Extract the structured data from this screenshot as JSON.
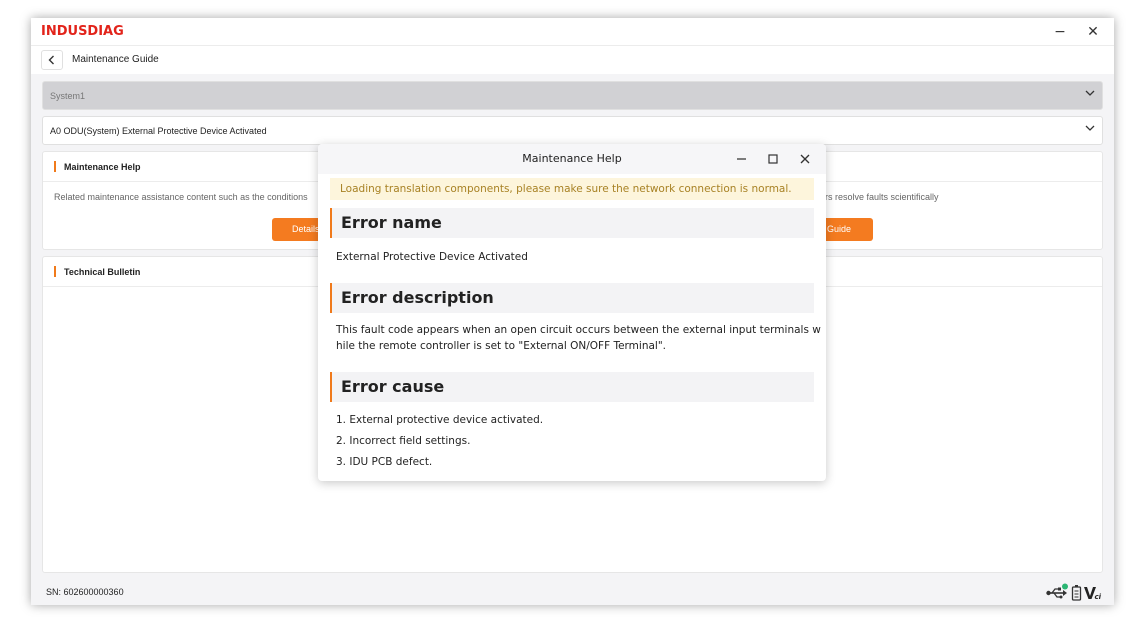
{
  "app": {
    "logo": "INDUSDIAG",
    "minimize": "−",
    "close": "✕"
  },
  "nav": {
    "title": "Maintenance Guide"
  },
  "selects": {
    "system": "System1",
    "fault": "A0 ODU(System) External Protective Device Activated"
  },
  "maintenance_help": {
    "title": "Maintenance Help",
    "desc_left": "Related maintenance assistance content such as the conditions",
    "desc_right": "ers resolve faults scientifically",
    "details_btn": "Details",
    "guide_btn": "Guide"
  },
  "technical_bulletin": {
    "title": "Technical Bulletin"
  },
  "status": {
    "sn": "SN: 602600000360"
  },
  "modal": {
    "title": "Maintenance Help",
    "notice": "Loading translation components, please make sure the network connection is normal.",
    "error_name_head": "Error name",
    "error_name": "External Protective Device Activated",
    "error_desc_head": "Error description",
    "error_desc_line1": "This fault code appears when an open circuit occurs between the external input terminals w",
    "error_desc_line2": "hile the remote controller is set to \"External ON/OFF Terminal\".",
    "error_cause_head": "Error cause",
    "causes": [
      "1. External protective device activated.",
      "2. Incorrect field settings.",
      "3. IDU PCB defect."
    ]
  },
  "colors": {
    "brand": "#e2231a",
    "accent": "#f47b20",
    "notice_bg": "#fdf5dc",
    "notice_text": "#a88225"
  },
  "icons": [
    "back-arrow-icon",
    "chevron-down-icon",
    "minimize-icon",
    "maximize-icon",
    "close-icon",
    "usb-icon",
    "battery-icon",
    "vci-icon"
  ]
}
